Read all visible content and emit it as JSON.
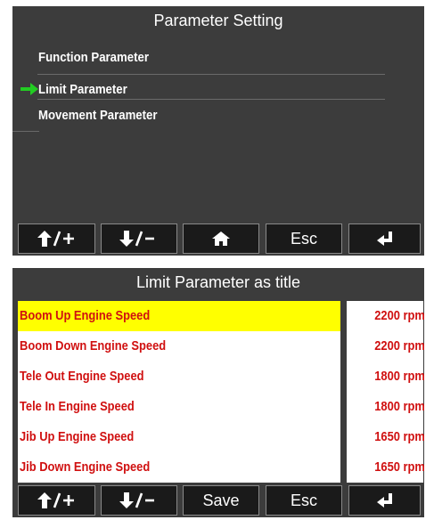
{
  "screen1": {
    "title": "Parameter Setting",
    "menu": [
      {
        "label": "Function Parameter",
        "selected": false
      },
      {
        "label": "Limit Parameter",
        "selected": true
      },
      {
        "label": "Movement Parameter",
        "selected": false
      }
    ],
    "buttons": [
      {
        "label": "↑/+",
        "icon": "up-plus-icon"
      },
      {
        "label": "↓/-",
        "icon": "down-minus-icon"
      },
      {
        "label": "",
        "icon": "home-icon"
      },
      {
        "label": "Esc",
        "icon": ""
      },
      {
        "label": "",
        "icon": "enter-icon"
      }
    ]
  },
  "screen2": {
    "title": "Limit Parameter as title",
    "rows": [
      {
        "label": "Boom Up Engine Speed",
        "value": "2200 rpm",
        "selected": true
      },
      {
        "label": "Boom Down Engine Speed",
        "value": "2200 rpm",
        "selected": false
      },
      {
        "label": "Tele Out Engine Speed",
        "value": "1800 rpm",
        "selected": false
      },
      {
        "label": "Tele In Engine Speed",
        "value": "1800 rpm",
        "selected": false
      },
      {
        "label": "Jib Up Engine Speed",
        "value": "1650 rpm",
        "selected": false
      },
      {
        "label": "Jib Down Engine Speed",
        "value": "1650 rpm",
        "selected": false
      }
    ],
    "buttons": [
      {
        "label": "↑/+",
        "icon": "up-plus-icon"
      },
      {
        "label": "↓/-",
        "icon": "down-minus-icon"
      },
      {
        "label": "Save",
        "icon": ""
      },
      {
        "label": "Esc",
        "icon": ""
      },
      {
        "label": "",
        "icon": "enter-icon"
      }
    ]
  },
  "colors": {
    "screen_bg": "#3c3c3c",
    "button_bg": "#1a1a1a",
    "selected_row": "#ffff00",
    "row_text": "#d01010",
    "arrow": "#22cc22"
  }
}
